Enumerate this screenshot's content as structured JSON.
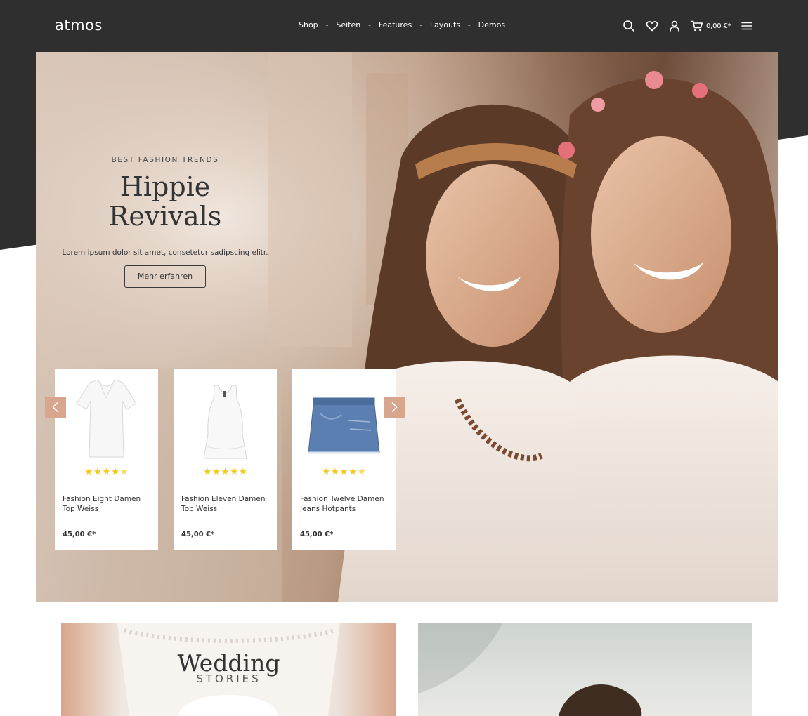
{
  "header": {
    "logo": "atmos",
    "nav": [
      "Shop",
      "Seiten",
      "Features",
      "Layouts",
      "Demos"
    ],
    "nav_separator": "-",
    "icons": [
      "search-icon",
      "heart-icon",
      "user-icon",
      "cart-icon",
      "menu-icon"
    ],
    "cart_total": "0,00 €*"
  },
  "hero": {
    "eyebrow": "BEST FASHION TRENDS",
    "title": "Hippie Revivals",
    "description": "Lorem ipsum dolor sit amet, consetetur sadipscing elitr.",
    "button": "Mehr erfahren"
  },
  "products": [
    {
      "name": "Fashion Eight Damen Top Weiss",
      "price": "45,00 €*",
      "rating": 4.5,
      "image": "white-tshirt"
    },
    {
      "name": "Fashion Eleven Damen Top Weiss",
      "price": "45,00 €*",
      "rating": 5,
      "image": "white-tank-top"
    },
    {
      "name": "Fashion Twelve Damen Jeans Hotpants",
      "price": "45,00 €*",
      "rating": 4.5,
      "image": "denim-skirt"
    }
  ],
  "slider": {
    "prev_icon": "chevron-left-icon",
    "next_icon": "chevron-right-icon"
  },
  "teasers": {
    "left": {
      "title": "Wedding",
      "subtitle": "STORIES"
    }
  },
  "colors": {
    "header_bg": "#2f2f2f",
    "accent": "#d8a68d",
    "star": "#f5c518",
    "text": "#333333"
  }
}
